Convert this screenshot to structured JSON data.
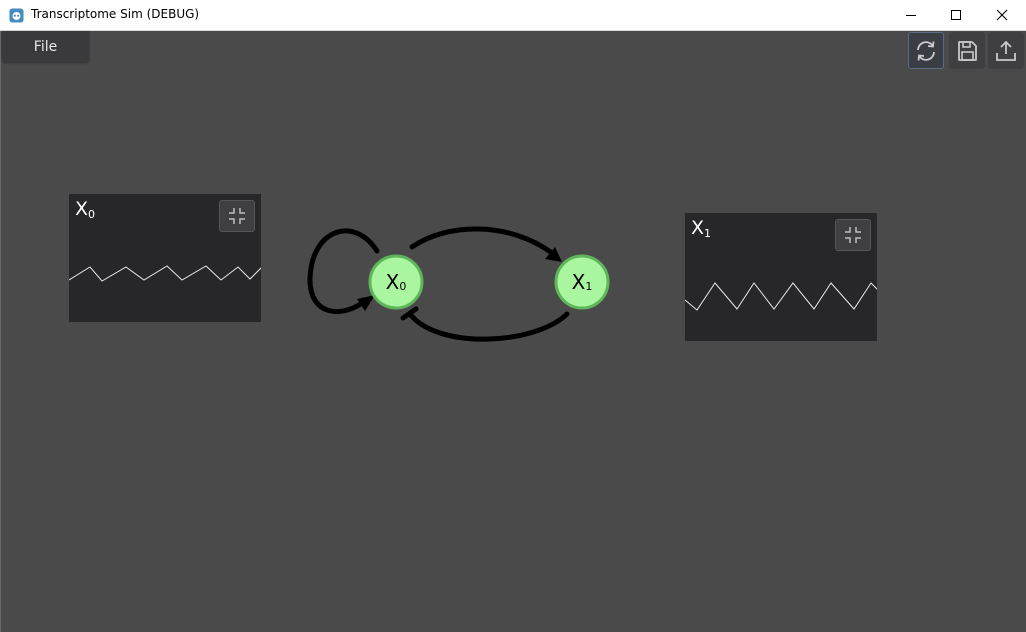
{
  "window": {
    "title": "Transcriptome Sim (DEBUG)",
    "controls": [
      "minimize-icon",
      "maximize-icon",
      "close-icon"
    ]
  },
  "menu": {
    "file_label": "File"
  },
  "toolbar": {
    "buttons": [
      {
        "name": "refresh",
        "icon": "refresh-icon",
        "active": true
      },
      {
        "name": "save",
        "icon": "save-icon",
        "active": false
      },
      {
        "name": "upload",
        "icon": "upload-icon",
        "active": false
      }
    ]
  },
  "network": {
    "nodes": [
      {
        "id": "X0",
        "base": "X",
        "sub": "0"
      },
      {
        "id": "X1",
        "base": "X",
        "sub": "1"
      }
    ],
    "edges": [
      {
        "from": "X0",
        "to": "X0",
        "type": "activation"
      },
      {
        "from": "X0",
        "to": "X1",
        "type": "activation"
      },
      {
        "from": "X1",
        "to": "X0",
        "type": "repression"
      }
    ],
    "node_color": "#aaf5a0",
    "node_border": "#5fb65a"
  },
  "plots": {
    "x0": {
      "base": "X",
      "sub": "0",
      "collapse_icon": "collapse-icon"
    },
    "x1": {
      "base": "X",
      "sub": "1",
      "collapse_icon": "collapse-icon"
    }
  },
  "colors": {
    "background": "#4a4a4a",
    "panel": "#27272a",
    "accent": "#5a6a88"
  }
}
